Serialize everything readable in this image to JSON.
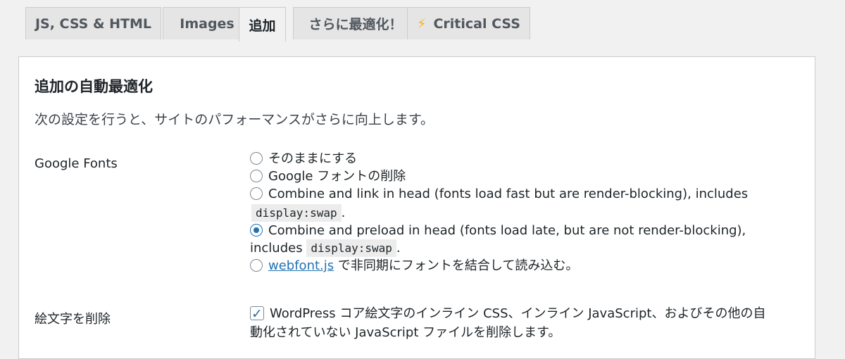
{
  "tabs": [
    {
      "label": "JS, CSS & HTML",
      "active": false
    },
    {
      "label": "Images",
      "active": false
    },
    {
      "label": "追加",
      "active": true
    },
    {
      "label": "さらに最適化！",
      "active": false
    },
    {
      "label": "Critical CSS",
      "icon": "lightning-bolt-icon",
      "active": false
    }
  ],
  "panel": {
    "title": "追加の自動最適化",
    "description": "次の設定を行うと、サイトのパフォーマンスがさらに向上します。"
  },
  "google_fonts": {
    "label": "Google Fonts",
    "options": [
      {
        "text": "そのままにする",
        "checked": false
      },
      {
        "text": "Google フォントの削除",
        "checked": false
      },
      {
        "text": "Combine and link in head (fonts load fast but are render-blocking), includes",
        "code": "display:swap",
        "suffix": ".",
        "checked": false
      },
      {
        "text": "Combine and preload in head (fonts load late, but are not render-blocking),",
        "text2": "includes",
        "code": "display:swap",
        "suffix": ".",
        "checked": true
      },
      {
        "link": "webfont.js",
        "text": "で非同期にフォントを結合して読み込む。",
        "checked": false
      }
    ]
  },
  "emoji": {
    "label": "絵文字を削除",
    "checkbox_text_line1": "WordPress コア絵文字のインライン CSS、インライン JavaScript、およびその他の自",
    "checkbox_text_line2": "動化されていない JavaScript ファイルを削除します。",
    "checked": true
  }
}
